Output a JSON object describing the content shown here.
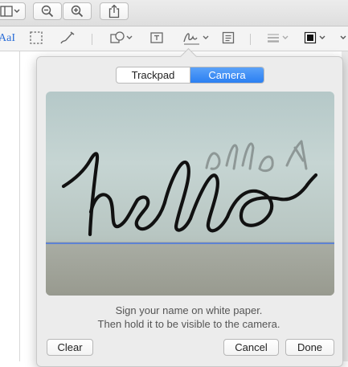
{
  "toolbar": {
    "markup_label": "AaI"
  },
  "popover": {
    "tabs": [
      {
        "label": "Trackpad",
        "active": false
      },
      {
        "label": "Camera",
        "active": true
      }
    ],
    "signature_preview": "hello",
    "instructions_line1": "Sign your name on white paper.",
    "instructions_line2": "Then hold it to be visible to the camera.",
    "buttons": {
      "clear": "Clear",
      "cancel": "Cancel",
      "done": "Done"
    }
  },
  "colors": {
    "accent": "#2a7ff2",
    "baseline": "#5d82d3"
  },
  "icons": [
    "sidebar-icon",
    "zoom-out-icon",
    "zoom-in-icon",
    "share-icon",
    "rect-select-icon",
    "sketch-icon",
    "shapes-icon",
    "text-box-icon",
    "signature-icon",
    "note-icon",
    "line-style-icon",
    "border-color-icon",
    "chevron-down-icon"
  ]
}
